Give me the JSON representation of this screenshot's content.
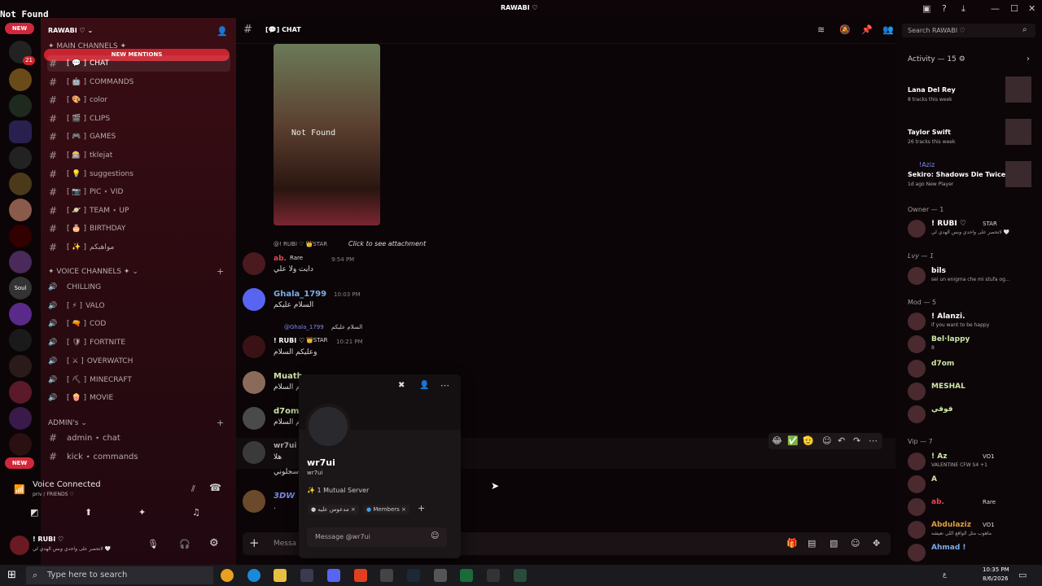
{
  "window": {
    "title": "RAWABI ♡",
    "not_found": "Not_Found"
  },
  "guild": {
    "name": "RAWABI ♡",
    "new_pill": "NEW",
    "new_mentions": "NEW MENTIONS",
    "servers_badge_top": "21"
  },
  "categories": {
    "main": "✦ MAIN CHANNELS ✦",
    "voice": "✦ VOICE CHANNELS ✦",
    "admin": "ADMIN's"
  },
  "channels": [
    {
      "emoji": "💬",
      "label": "CHAT"
    },
    {
      "emoji": "🤖",
      "label": "COMMANDS"
    },
    {
      "emoji": "🎨",
      "label": "color"
    },
    {
      "emoji": "🎬",
      "label": "CLIPS"
    },
    {
      "emoji": "🎮",
      "label": "GAMES"
    },
    {
      "emoji": "🎰",
      "label": "tklejat"
    },
    {
      "emoji": "💡",
      "label": "suggestions"
    },
    {
      "emoji": "📷",
      "label": "PIC ⋆ VID"
    },
    {
      "emoji": "🪐",
      "label": "TEAM ⋆ UP"
    },
    {
      "emoji": "🎂",
      "label": "BIRTHDAY"
    },
    {
      "emoji": "✨",
      "label": "مواهبكم"
    }
  ],
  "voice_channels": [
    {
      "emoji": "",
      "label": "CHILLING"
    },
    {
      "emoji": "⚡",
      "label": "VALO"
    },
    {
      "emoji": "🔫",
      "label": "COD"
    },
    {
      "emoji": "🛡",
      "label": "FORTNITE"
    },
    {
      "emoji": "⚔",
      "label": "OVERWATCH"
    },
    {
      "emoji": "⛏",
      "label": "MINECRAFT"
    },
    {
      "emoji": "🍿",
      "label": "MOVIE"
    }
  ],
  "admin_channels": [
    {
      "label": "admin ⋆ chat"
    },
    {
      "label": "kick ⋆ commands"
    }
  ],
  "voice": {
    "status": "Voice Connected",
    "location": "priv / FRIENDS ♡"
  },
  "user": {
    "name": "! RUBI ♡",
    "status": "لاتحصر على واحدي وبس الهدي لي 🤍"
  },
  "chat": {
    "channel": "CHAT",
    "not_found": "Not Found",
    "reply1": "@! RUBI ♡",
    "reply1_tag": "STAR",
    "reply1_attach": "Click to see attachment",
    "msg1_name": "ab.",
    "msg1_tag": "Rare",
    "msg1_time": "9:54 PM",
    "msg1_text": "دايت ولا علي",
    "msg2_name": "Ghala_1799",
    "msg2_time": "10:03 PM",
    "msg2_text": "السلام عليكم",
    "reply3": "@Ghala_1799",
    "reply3_text": "السلام عليكم",
    "msg3_name": "! RUBI ♡",
    "msg3_tag": "STAR",
    "msg3_time": "10:21 PM",
    "msg3_text": "وعليكم السلام",
    "msg4_name": "Muath",
    "msg4_text": "كم السلام",
    "msg5_name": "d7om",
    "msg5_text": "كم السلام",
    "msg6_name": "wr7ui",
    "msg6_text1": "هلا",
    "msg6_text2": "اسجلوني",
    "msg7_name": "3DW",
    "msg7_text": ".",
    "composer_placeholder": "Messa"
  },
  "popup": {
    "display": "wr7ui",
    "username": "wr7ui",
    "mutual": "1 Mutual Server",
    "role1": "مدعوس عليه",
    "role2": "Members",
    "message_placeholder": "Message @wr7ui"
  },
  "search": {
    "placeholder": "Search RAWABI ♡"
  },
  "activity": {
    "header": "Activity — 15",
    "items": [
      {
        "title": "Lana Del Rey",
        "sub": "8 tracks this week"
      },
      {
        "title": "Taylor Swift",
        "sub": "26 tracks this week"
      },
      {
        "title": "Sekiro: Shadows Die Twice ...",
        "sub": "1d ago  New Player",
        "user": "!Aziz"
      }
    ]
  },
  "members": {
    "owner": "Owner — 1",
    "lvy": "Lvy — 1",
    "mod": "Mod — 5",
    "vip": "Vip — 7",
    "list": [
      {
        "name": "! RUBI ♡",
        "sub": "لاتحصر على واحدي وبس الهدي لي 🤍",
        "tag": "STAR",
        "color": "#ffffff"
      },
      {
        "name": "bils",
        "sub": "sei un enigma che mi stufa og...",
        "color": "#ffffff"
      },
      {
        "name": "! Alanzi.",
        "sub": "if you want to be happy",
        "color": "#ffffff"
      },
      {
        "name": "Bel·lappy",
        "sub": "8",
        "color": "#cde8a8"
      },
      {
        "name": "d7om",
        "sub": "",
        "color": "#cde8a8"
      },
      {
        "name": "MESHAL",
        "sub": "",
        "color": "#cde8a8"
      },
      {
        "name": "قوقي",
        "sub": "",
        "color": "#cde8a8"
      },
      {
        "name": "! Az",
        "sub": "VALENTINE CFW S4 +1",
        "tag": "VO1",
        "color": "#cde8a8"
      },
      {
        "name": "A",
        "sub": "",
        "color": "#cde8a8"
      },
      {
        "name": "ab.",
        "sub": "",
        "tag": "Rare",
        "color": "#e04a55"
      },
      {
        "name": "Abdulaziz",
        "sub": "ماهوب مثل الواقع اللي نعيشه",
        "tag": "VO1",
        "color": "#e0a040"
      },
      {
        "name": "Ahmad !",
        "sub": "",
        "color": "#7aaee8"
      }
    ]
  },
  "taskbar": {
    "search": "Type here to search",
    "time": "10:35 PM",
    "date": "8/6/2026",
    "lang": "ع"
  },
  "colors": {
    "accent": "#c8242f",
    "bg": "#0b0507",
    "sidebar": "#2a0a10"
  }
}
